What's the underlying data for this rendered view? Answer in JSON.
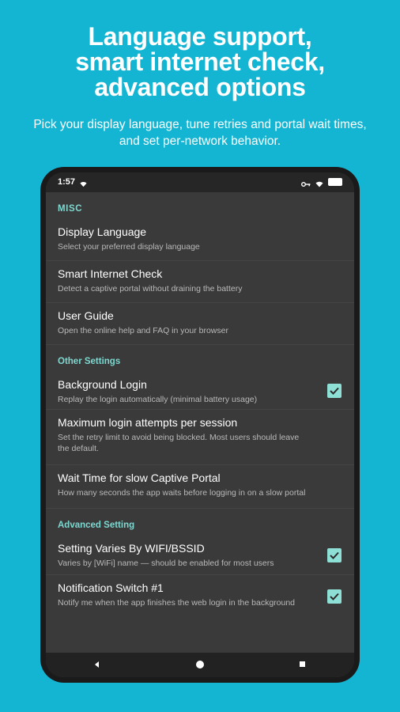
{
  "promo": {
    "headline_lines": [
      "Language support,",
      "smart internet check,",
      "advanced options"
    ],
    "subtitle_lines": [
      "Pick your display language, tune retries and portal wait times,",
      "and set per-network behavior."
    ]
  },
  "status_bar": {
    "time": "1:57",
    "icons": [
      "wifi-icon",
      "key-icon",
      "wifi-icon",
      "battery-icon"
    ]
  },
  "sections": [
    {
      "header": "MISC",
      "items": [
        {
          "title": "Display Language",
          "summary": "Select your preferred display language"
        },
        {
          "title": "Smart Internet Check",
          "summary": "Detect a captive portal without draining the battery"
        },
        {
          "title": "User Guide",
          "summary": "Open the online help and FAQ in your browser"
        }
      ]
    },
    {
      "header": "Other Settings",
      "items": [
        {
          "title": "Background Login",
          "summary": "Replay the login automatically (minimal battery usage)",
          "checked": true
        },
        {
          "title": "Maximum login attempts per session",
          "summary": "Set the retry limit to avoid being blocked. Most users should leave the default."
        },
        {
          "title": "Wait Time for slow Captive Portal",
          "summary": "How many seconds the app waits before logging in on a slow portal"
        }
      ]
    },
    {
      "header": "Advanced Setting",
      "items": [
        {
          "title": "Setting Varies By WIFI/BSSID",
          "summary": "Varies by [WiFi] name — should be enabled for most users",
          "checked": true
        },
        {
          "title": "Notification Switch #1",
          "summary": "Notify me when the app finishes the web login in the background",
          "checked": true
        }
      ]
    }
  ],
  "nav_bar": {
    "buttons": [
      "back-icon",
      "home-icon",
      "recents-icon"
    ]
  },
  "colors": {
    "background": "#13b5d3",
    "accent": "#7ed8d0",
    "checkbox": "#8ee0d6",
    "screen": "#3a3a3a"
  }
}
